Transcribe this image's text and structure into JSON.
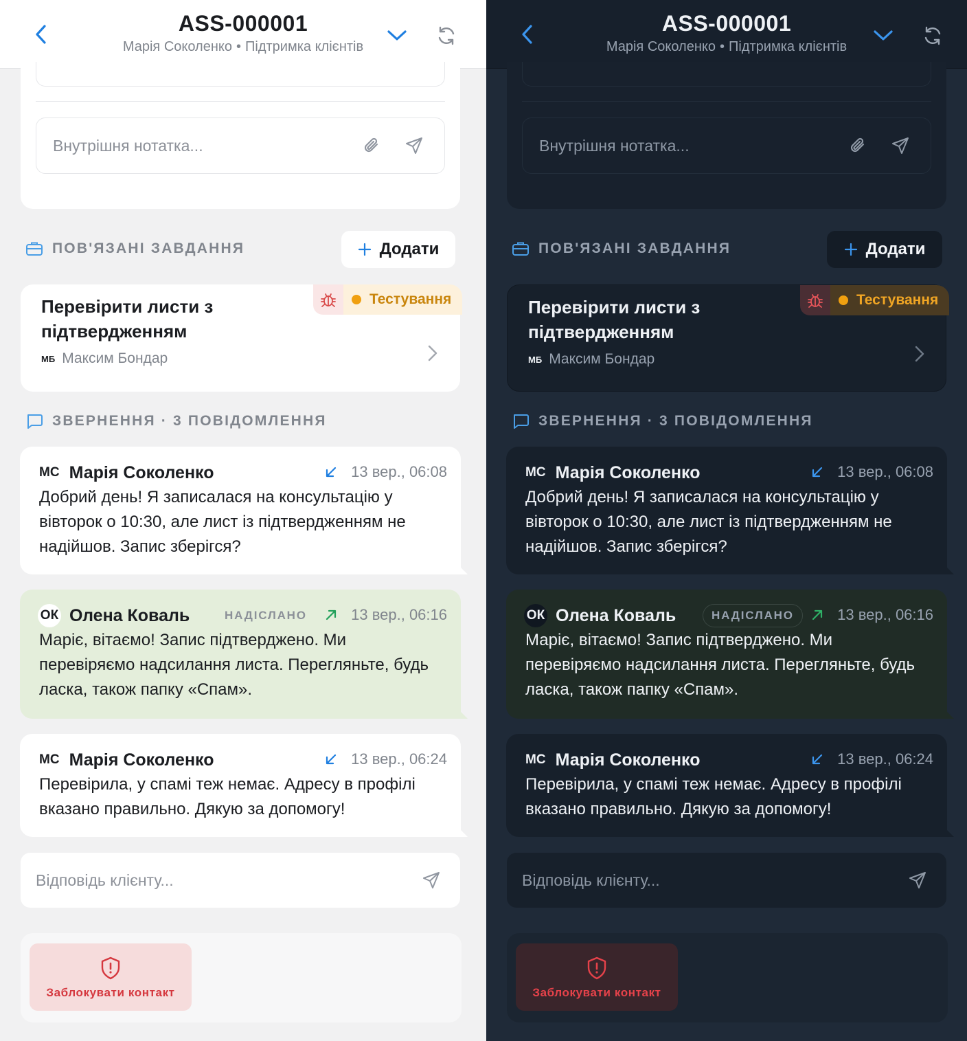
{
  "header": {
    "title": "ASS-000001",
    "customer": "Марія Соколенко",
    "separator": "•",
    "department": "Підтримка клієнтів"
  },
  "note": {
    "placeholder": "Внутрішня нотатка..."
  },
  "tasks_section": {
    "label": "ПОВ'ЯЗАНІ ЗАВДАННЯ",
    "add_label": "Додати",
    "tasks": [
      {
        "title": "Перевірити листи з підтвердженням",
        "status": "Тестування",
        "assignee_initials": "МБ",
        "assignee": "Максим Бондар"
      }
    ]
  },
  "conversation": {
    "label": "ЗВЕРНЕННЯ · 3 ПОВІДОМЛЕННЯ",
    "messages": [
      {
        "initials": "МС",
        "author": "Марія Соколенко",
        "direction": "incoming",
        "time": "13 вер., 06:08",
        "text": "Добрий день! Я записалася на консультацію у вівторок о 10:30, але лист із підтвердженням не надійшов. Запис зберігся?"
      },
      {
        "initials": "ОК",
        "author": "Олена Коваль",
        "badge": "НАДІСЛАНО",
        "direction": "outgoing",
        "time": "13 вер., 06:16",
        "text": "Маріє, вітаємо! Запис підтверджено. Ми перевіряємо надсилання листа. Перегляньте, будь ласка, також папку «Спам»."
      },
      {
        "initials": "МС",
        "author": "Марія Соколенко",
        "direction": "incoming",
        "time": "13 вер., 06:24",
        "text": "Перевірила, у спамі теж немає. Адресу в профілі вказано правильно. Дякую за допомогу!"
      }
    ]
  },
  "reply": {
    "placeholder": "Відповідь клієнту..."
  },
  "block": {
    "label": "Заблокувати контакт"
  },
  "colors": {
    "accent_blue": "#1f7fe0",
    "incoming_arrow": "#1f7fe0",
    "outgoing_arrow": "#22a05a",
    "status_dot": "#f0a010",
    "danger": "#d5383f"
  },
  "themes": [
    "light",
    "dark"
  ]
}
